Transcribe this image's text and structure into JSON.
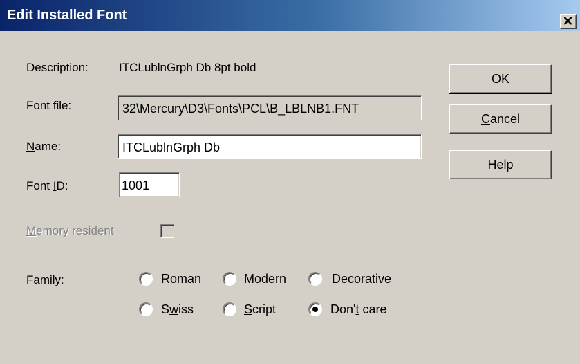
{
  "window": {
    "title": "Edit Installed Font",
    "close_glyph": "x-icon"
  },
  "form": {
    "description_label": "Description:",
    "description_value": "ITCLublnGrph  Db 8pt  bold",
    "font_file_label": "Font file:",
    "font_file_value": "32\\Mercury\\D3\\Fonts\\PCL\\B_LBLNB1.FNT",
    "name_label_access": "N",
    "name_label_rest": "ame:",
    "name_value": "ITCLublnGrph  Db",
    "font_id_label_pre": "Font ",
    "font_id_label_access": "I",
    "font_id_label_post": "D:",
    "font_id_value": "1001",
    "memory_label_access": "M",
    "memory_label_rest": "emory resident",
    "memory_checked": false,
    "family_label": "Family:"
  },
  "buttons": {
    "ok_access": "O",
    "ok_rest": "K",
    "cancel_access": "C",
    "cancel_rest": "ancel",
    "help_access": "H",
    "help_rest": "elp"
  },
  "family": {
    "roman_access": "R",
    "roman_rest": "oman",
    "modern_pre": "Mod",
    "modern_access": "e",
    "modern_post": "rn",
    "decorative_access": "D",
    "decorative_rest": "ecorative",
    "swiss_pre": "S",
    "swiss_access": "w",
    "swiss_post": "iss",
    "script_access": "S",
    "script_rest": "cript",
    "dontcare_pre": "Don'",
    "dontcare_access": "t",
    "dontcare_post": " care",
    "selected": "dontcare"
  }
}
